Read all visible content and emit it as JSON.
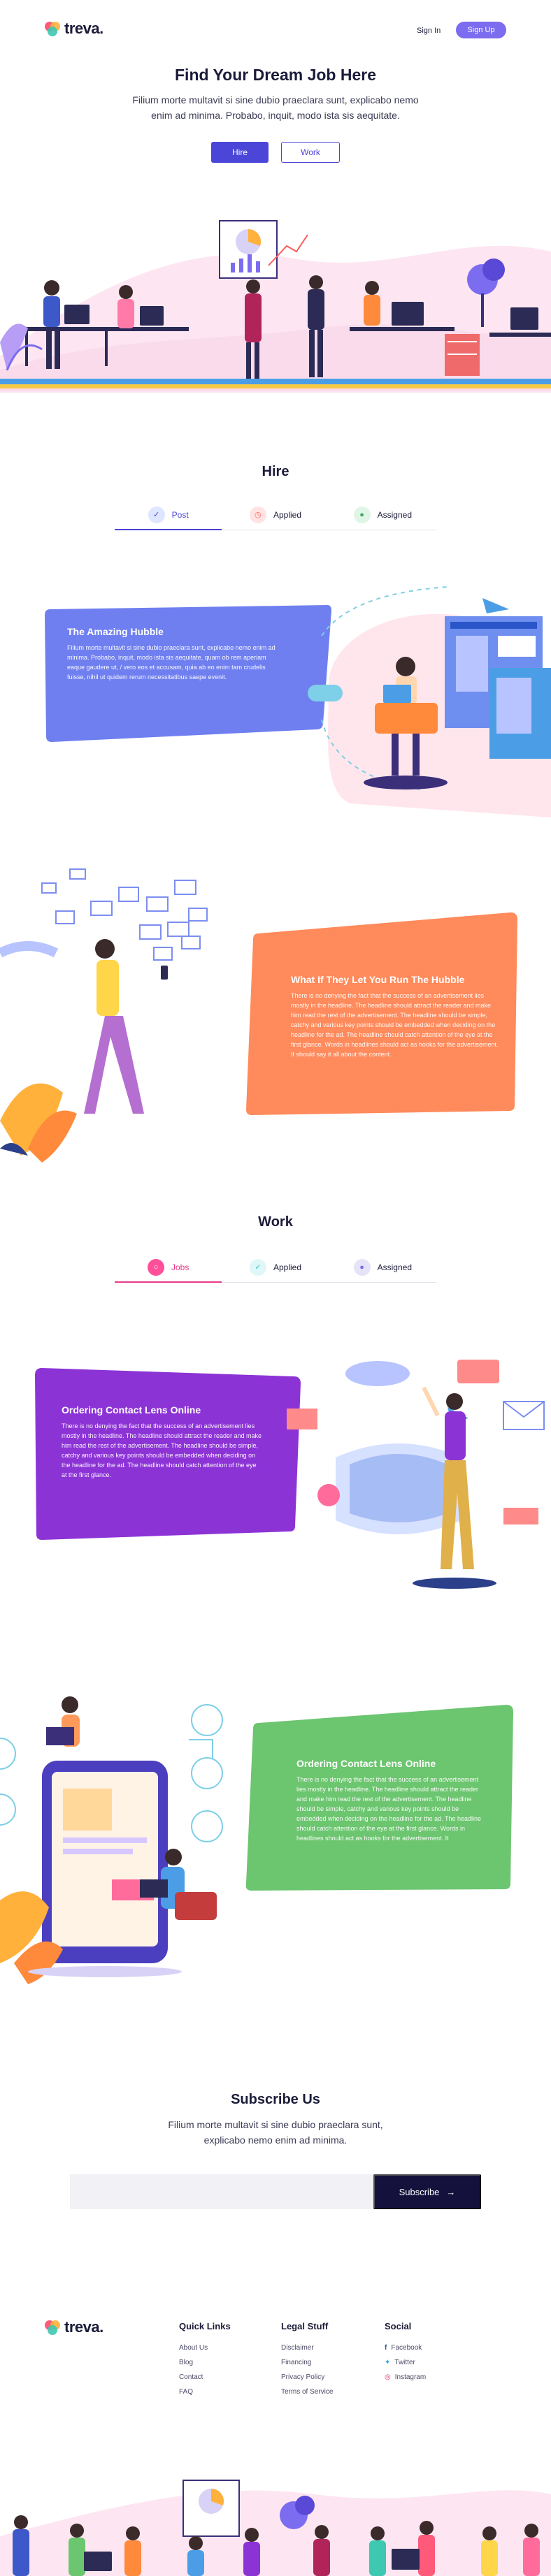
{
  "header": {
    "brand": "treva.",
    "signin": "Sign In",
    "signup": "Sign Up"
  },
  "hero": {
    "title": "Find Your Dream Job Here",
    "subtitle": "Filium morte multavit si sine dubio praeclara sunt, explicabo nemo enim ad minima. Probabo, inquit, modo ista sis aequitate.",
    "hire_button": "Hire",
    "work_button": "Work"
  },
  "hire": {
    "title": "Hire",
    "tabs": [
      {
        "label": "Post",
        "icon": "check-icon",
        "active": true
      },
      {
        "label": "Applied",
        "icon": "clock-icon",
        "active": false
      },
      {
        "label": "Assigned",
        "icon": "user-icon",
        "active": false
      }
    ],
    "card1": {
      "title": "The Amazing Hubble",
      "text": "Filium morte multavit si sine dubio praeclara sunt, explicabo nemo enim ad minima. Probabo, inquit, modo ista sis aequitate, quam ob rem aperiam eaque gaudere ut, / vero eos et accusam, quia ab eo enim tam crudelis fuisse, nihil ut quidem rerum necessitatibus saepe evenit."
    },
    "card2": {
      "title": "What If They Let You Run The Hubble",
      "text": "There is no denying the fact that the success of an advertisement lies mostly in the headline. The headline should attract the reader and make him read the rest of the advertisement. The headline should be simple, catchy and various key points should be embedded when deciding on the headline for the ad. The headline should catch attention of the eye at the first glance. Words in headlines should act as hooks for the advertisement. It should say it all about the content."
    }
  },
  "work": {
    "title": "Work",
    "tabs": [
      {
        "label": "Jobs",
        "icon": "circle-icon",
        "active": true
      },
      {
        "label": "Applied",
        "icon": "check-icon",
        "active": false
      },
      {
        "label": "Assigned",
        "icon": "user-icon",
        "active": false
      }
    ],
    "card1": {
      "title": "Ordering Contact Lens Online",
      "text": "There is no denying the fact that the success of an advertisement lies mostly in the headline. The headline should attract the reader and make him read the rest of the advertisement. The headline should be simple, catchy and various key points should be embedded when deciding on the headline for the ad. The headline should catch attention of the eye at the first glance."
    },
    "card2": {
      "title": "Ordering Contact Lens Online",
      "text": "There is no denying the fact that the success of an advertisement lies mostly in the headline. The headline should attract the reader and make him read the rest of the advertisement. The headline should be simple, catchy and various key points should be embedded when deciding on the headline for the ad. The headline should catch attention of the eye at the first glance. Words in headlines should act as hooks for the advertisement. It"
    }
  },
  "subscribe": {
    "title": "Subscribe Us",
    "text": "Filium morte multavit si sine dubio praeclara sunt, explicabo nemo enim ad minima.",
    "placeholder": "",
    "button": "Subscribe"
  },
  "footer": {
    "brand": "treva.",
    "quick_links": {
      "title": "Quick Links",
      "items": [
        "About Us",
        "Blog",
        "Contact",
        "FAQ"
      ]
    },
    "legal": {
      "title": "Legal Stuff",
      "items": [
        "Disclaimer",
        "Financing",
        "Privacy Policy",
        "Terms of Service"
      ]
    },
    "social": {
      "title": "Social",
      "items": [
        "Facebook",
        "Twitter",
        "Instagram"
      ]
    }
  },
  "colors": {
    "primary": "#4b45d8",
    "blue_card": "#6f7ff0",
    "orange_card": "#ff8a5b",
    "purple_card": "#8c33d6",
    "green_card": "#6cc56f",
    "dark": "#15113d"
  }
}
